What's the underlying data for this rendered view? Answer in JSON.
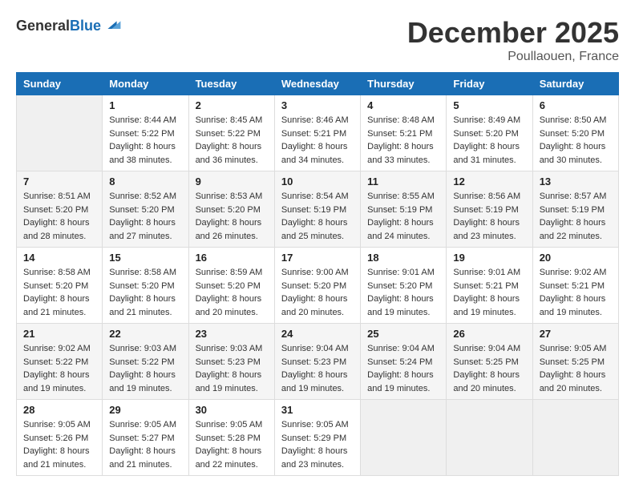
{
  "header": {
    "logo_general": "General",
    "logo_blue": "Blue",
    "month": "December 2025",
    "location": "Poullaouen, France"
  },
  "weekdays": [
    "Sunday",
    "Monday",
    "Tuesday",
    "Wednesday",
    "Thursday",
    "Friday",
    "Saturday"
  ],
  "weeks": [
    [
      {
        "day": "",
        "sunrise": "",
        "sunset": "",
        "daylight": ""
      },
      {
        "day": "1",
        "sunrise": "Sunrise: 8:44 AM",
        "sunset": "Sunset: 5:22 PM",
        "daylight": "Daylight: 8 hours and 38 minutes."
      },
      {
        "day": "2",
        "sunrise": "Sunrise: 8:45 AM",
        "sunset": "Sunset: 5:22 PM",
        "daylight": "Daylight: 8 hours and 36 minutes."
      },
      {
        "day": "3",
        "sunrise": "Sunrise: 8:46 AM",
        "sunset": "Sunset: 5:21 PM",
        "daylight": "Daylight: 8 hours and 34 minutes."
      },
      {
        "day": "4",
        "sunrise": "Sunrise: 8:48 AM",
        "sunset": "Sunset: 5:21 PM",
        "daylight": "Daylight: 8 hours and 33 minutes."
      },
      {
        "day": "5",
        "sunrise": "Sunrise: 8:49 AM",
        "sunset": "Sunset: 5:20 PM",
        "daylight": "Daylight: 8 hours and 31 minutes."
      },
      {
        "day": "6",
        "sunrise": "Sunrise: 8:50 AM",
        "sunset": "Sunset: 5:20 PM",
        "daylight": "Daylight: 8 hours and 30 minutes."
      }
    ],
    [
      {
        "day": "7",
        "sunrise": "Sunrise: 8:51 AM",
        "sunset": "Sunset: 5:20 PM",
        "daylight": "Daylight: 8 hours and 28 minutes."
      },
      {
        "day": "8",
        "sunrise": "Sunrise: 8:52 AM",
        "sunset": "Sunset: 5:20 PM",
        "daylight": "Daylight: 8 hours and 27 minutes."
      },
      {
        "day": "9",
        "sunrise": "Sunrise: 8:53 AM",
        "sunset": "Sunset: 5:20 PM",
        "daylight": "Daylight: 8 hours and 26 minutes."
      },
      {
        "day": "10",
        "sunrise": "Sunrise: 8:54 AM",
        "sunset": "Sunset: 5:19 PM",
        "daylight": "Daylight: 8 hours and 25 minutes."
      },
      {
        "day": "11",
        "sunrise": "Sunrise: 8:55 AM",
        "sunset": "Sunset: 5:19 PM",
        "daylight": "Daylight: 8 hours and 24 minutes."
      },
      {
        "day": "12",
        "sunrise": "Sunrise: 8:56 AM",
        "sunset": "Sunset: 5:19 PM",
        "daylight": "Daylight: 8 hours and 23 minutes."
      },
      {
        "day": "13",
        "sunrise": "Sunrise: 8:57 AM",
        "sunset": "Sunset: 5:19 PM",
        "daylight": "Daylight: 8 hours and 22 minutes."
      }
    ],
    [
      {
        "day": "14",
        "sunrise": "Sunrise: 8:58 AM",
        "sunset": "Sunset: 5:20 PM",
        "daylight": "Daylight: 8 hours and 21 minutes."
      },
      {
        "day": "15",
        "sunrise": "Sunrise: 8:58 AM",
        "sunset": "Sunset: 5:20 PM",
        "daylight": "Daylight: 8 hours and 21 minutes."
      },
      {
        "day": "16",
        "sunrise": "Sunrise: 8:59 AM",
        "sunset": "Sunset: 5:20 PM",
        "daylight": "Daylight: 8 hours and 20 minutes."
      },
      {
        "day": "17",
        "sunrise": "Sunrise: 9:00 AM",
        "sunset": "Sunset: 5:20 PM",
        "daylight": "Daylight: 8 hours and 20 minutes."
      },
      {
        "day": "18",
        "sunrise": "Sunrise: 9:01 AM",
        "sunset": "Sunset: 5:20 PM",
        "daylight": "Daylight: 8 hours and 19 minutes."
      },
      {
        "day": "19",
        "sunrise": "Sunrise: 9:01 AM",
        "sunset": "Sunset: 5:21 PM",
        "daylight": "Daylight: 8 hours and 19 minutes."
      },
      {
        "day": "20",
        "sunrise": "Sunrise: 9:02 AM",
        "sunset": "Sunset: 5:21 PM",
        "daylight": "Daylight: 8 hours and 19 minutes."
      }
    ],
    [
      {
        "day": "21",
        "sunrise": "Sunrise: 9:02 AM",
        "sunset": "Sunset: 5:22 PM",
        "daylight": "Daylight: 8 hours and 19 minutes."
      },
      {
        "day": "22",
        "sunrise": "Sunrise: 9:03 AM",
        "sunset": "Sunset: 5:22 PM",
        "daylight": "Daylight: 8 hours and 19 minutes."
      },
      {
        "day": "23",
        "sunrise": "Sunrise: 9:03 AM",
        "sunset": "Sunset: 5:23 PM",
        "daylight": "Daylight: 8 hours and 19 minutes."
      },
      {
        "day": "24",
        "sunrise": "Sunrise: 9:04 AM",
        "sunset": "Sunset: 5:23 PM",
        "daylight": "Daylight: 8 hours and 19 minutes."
      },
      {
        "day": "25",
        "sunrise": "Sunrise: 9:04 AM",
        "sunset": "Sunset: 5:24 PM",
        "daylight": "Daylight: 8 hours and 19 minutes."
      },
      {
        "day": "26",
        "sunrise": "Sunrise: 9:04 AM",
        "sunset": "Sunset: 5:25 PM",
        "daylight": "Daylight: 8 hours and 20 minutes."
      },
      {
        "day": "27",
        "sunrise": "Sunrise: 9:05 AM",
        "sunset": "Sunset: 5:25 PM",
        "daylight": "Daylight: 8 hours and 20 minutes."
      }
    ],
    [
      {
        "day": "28",
        "sunrise": "Sunrise: 9:05 AM",
        "sunset": "Sunset: 5:26 PM",
        "daylight": "Daylight: 8 hours and 21 minutes."
      },
      {
        "day": "29",
        "sunrise": "Sunrise: 9:05 AM",
        "sunset": "Sunset: 5:27 PM",
        "daylight": "Daylight: 8 hours and 21 minutes."
      },
      {
        "day": "30",
        "sunrise": "Sunrise: 9:05 AM",
        "sunset": "Sunset: 5:28 PM",
        "daylight": "Daylight: 8 hours and 22 minutes."
      },
      {
        "day": "31",
        "sunrise": "Sunrise: 9:05 AM",
        "sunset": "Sunset: 5:29 PM",
        "daylight": "Daylight: 8 hours and 23 minutes."
      },
      {
        "day": "",
        "sunrise": "",
        "sunset": "",
        "daylight": ""
      },
      {
        "day": "",
        "sunrise": "",
        "sunset": "",
        "daylight": ""
      },
      {
        "day": "",
        "sunrise": "",
        "sunset": "",
        "daylight": ""
      }
    ]
  ]
}
